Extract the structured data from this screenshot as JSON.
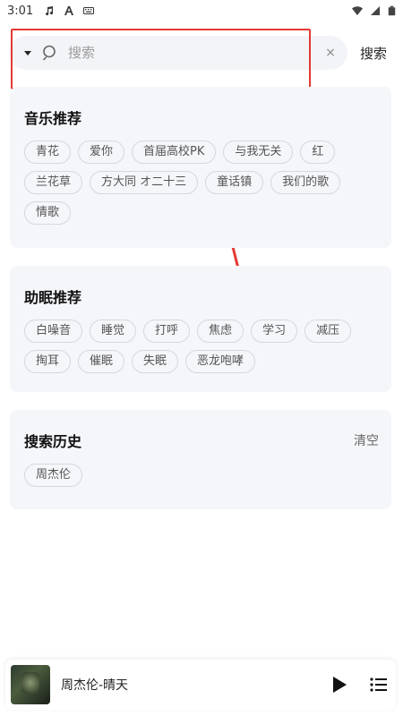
{
  "status_bar": {
    "time": "3:01",
    "left_icons": [
      "music-note-icon",
      "font-a-icon",
      "keyboard-icon"
    ],
    "right_icons": [
      "wifi-icon",
      "signal-icon",
      "battery-icon"
    ]
  },
  "search": {
    "placeholder": "搜索",
    "value": "",
    "button_label": "搜索",
    "clear_glyph": "×"
  },
  "music_recommend": {
    "title": "音乐推荐",
    "tags": [
      "青花",
      "爱你",
      "首届高校PK",
      "与我无关",
      "红",
      "兰花草",
      "方大同 オ二十三",
      "童话镇",
      "我们的歌",
      "情歌"
    ]
  },
  "sleep_recommend": {
    "title": "助眠推荐",
    "tags": [
      "白噪音",
      "睡觉",
      "打呼",
      "焦虑",
      "学习",
      "减压",
      "掏耳",
      "催眠",
      "失眠",
      "恶龙咆哮"
    ]
  },
  "history": {
    "title": "搜索历史",
    "clear_label": "清空",
    "tags": [
      "周杰伦"
    ]
  },
  "player": {
    "song": "周杰伦-晴天"
  },
  "colors": {
    "annotation_red": "#e53935",
    "card_bg": "#f5f6fa",
    "search_bg": "#f3f4f8"
  }
}
